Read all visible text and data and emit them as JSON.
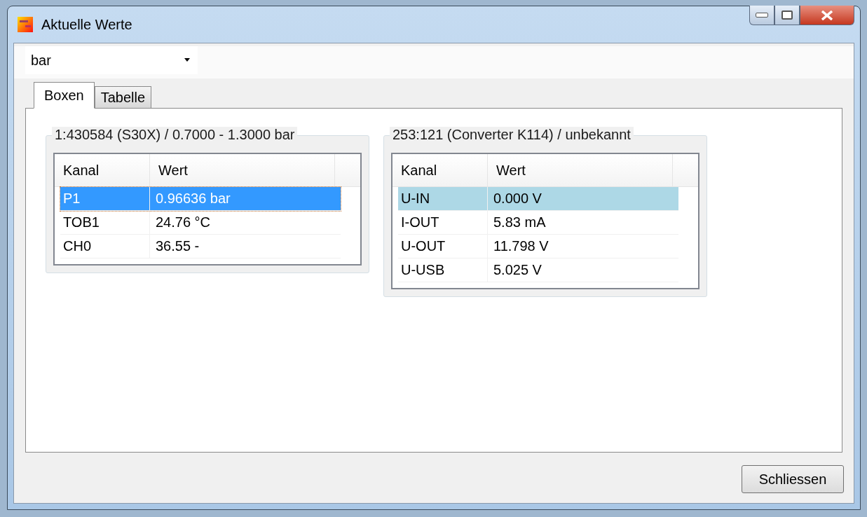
{
  "window": {
    "title": "Aktuelle Werte"
  },
  "unit_select": {
    "value": "bar"
  },
  "tabs": [
    {
      "label": "Boxen",
      "selected": true
    },
    {
      "label": "Tabelle",
      "selected": false
    }
  ],
  "boxes": [
    {
      "title": "1:430584 (S30X) / 0.7000 - 1.3000 bar",
      "focused": true,
      "columns": [
        "Kanal",
        "Wert"
      ],
      "rows": [
        {
          "cells": [
            "P1",
            "0.96636 bar"
          ],
          "selected": true
        },
        {
          "cells": [
            "TOB1",
            "24.76 °C"
          ],
          "selected": false
        },
        {
          "cells": [
            "CH0",
            "36.55 -"
          ],
          "selected": false
        }
      ]
    },
    {
      "title": "253:121 (Converter K114) / unbekannt",
      "focused": false,
      "columns": [
        "Kanal",
        "Wert"
      ],
      "rows": [
        {
          "cells": [
            "U-IN",
            "0.000 V"
          ],
          "selected": true
        },
        {
          "cells": [
            "I-OUT",
            "5.83 mA"
          ],
          "selected": false
        },
        {
          "cells": [
            "U-OUT",
            "11.798 V"
          ],
          "selected": false
        },
        {
          "cells": [
            "U-USB",
            "5.025 V"
          ],
          "selected": false
        }
      ]
    }
  ],
  "buttons": {
    "close": "Schliessen"
  }
}
